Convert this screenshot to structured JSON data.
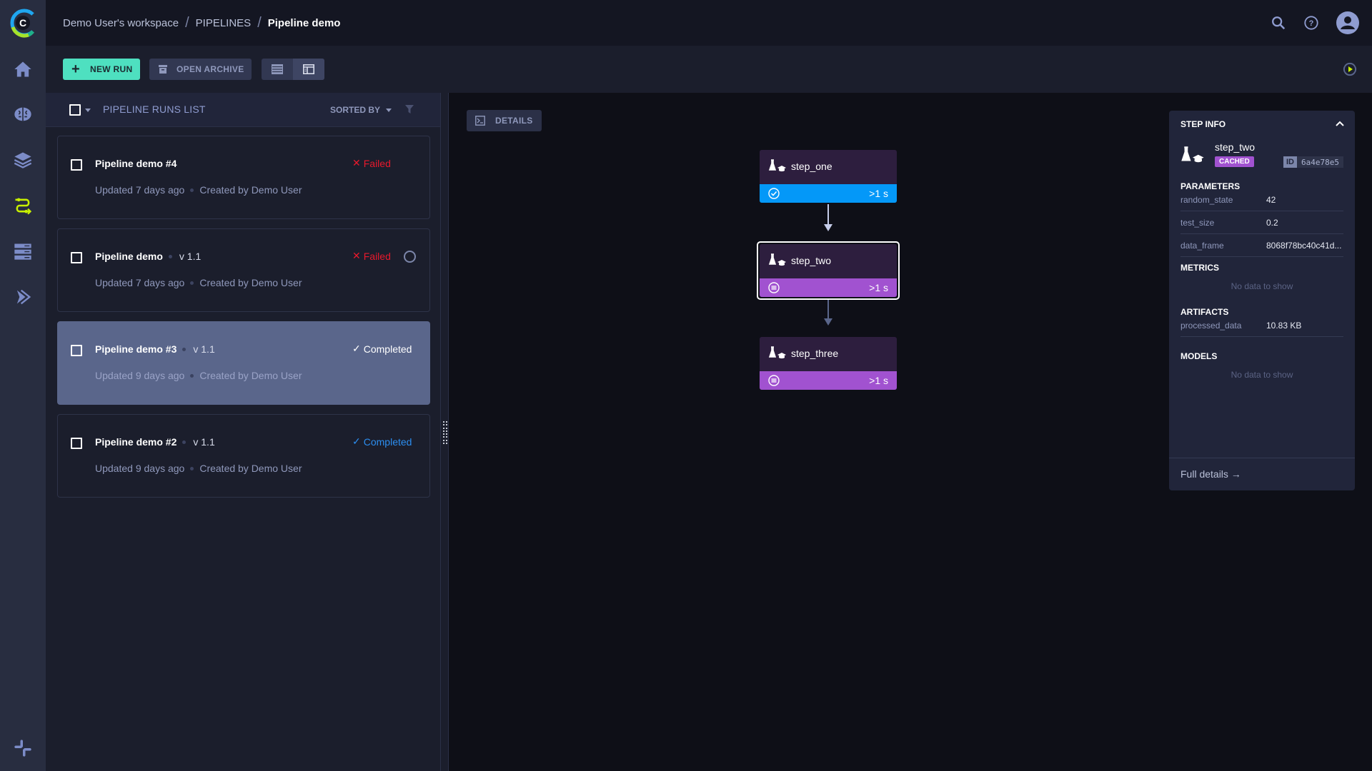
{
  "app": {
    "brand_colors": {
      "accent_green": "#4ee0c0",
      "active_nav": "#c8f000",
      "failed": "#e8192c",
      "completed_blue": "#2c8ef0",
      "step_blue": "#0498f8",
      "cached_purple": "#a152d0"
    }
  },
  "breadcrumb": {
    "workspace": "Demo User's workspace",
    "section": "PIPELINES",
    "current": "Pipeline demo",
    "separator": "/"
  },
  "sidebar": {
    "items": [
      {
        "name": "home",
        "icon": "home-icon"
      },
      {
        "name": "models",
        "icon": "brain-icon"
      },
      {
        "name": "datasets",
        "icon": "layers-icon"
      },
      {
        "name": "pipelines",
        "icon": "pipeline-icon",
        "active": true
      },
      {
        "name": "orchestration",
        "icon": "server-icon"
      },
      {
        "name": "deploy",
        "icon": "forward-icon"
      }
    ],
    "bottom": {
      "name": "slack",
      "icon": "slack-icon"
    }
  },
  "header_icons": {
    "search": "search-icon",
    "help": "help-icon",
    "profile": "user-avatar-icon"
  },
  "toolbar": {
    "new_run_label": "NEW RUN",
    "open_archive_label": "OPEN ARCHIVE",
    "views": [
      "table-view",
      "details-view"
    ],
    "active_view": "details-view"
  },
  "list": {
    "title": "PIPELINE RUNS LIST",
    "sort_label": "SORTED BY",
    "runs": [
      {
        "name": "Pipeline demo #4",
        "version": "",
        "status": "Failed",
        "updated": "Updated 7 days ago",
        "created_by": "Created by Demo User",
        "selected": false
      },
      {
        "name": "Pipeline demo",
        "version": "v 1.1",
        "status": "Failed",
        "updated": "Updated 7 days ago",
        "created_by": "Created by Demo User",
        "selected": false
      },
      {
        "name": "Pipeline demo #3",
        "version": "v 1.1",
        "status": "Completed",
        "updated": "Updated 9 days ago",
        "created_by": "Created by Demo User",
        "selected": true
      },
      {
        "name": "Pipeline demo #2",
        "version": "v 1.1",
        "status": "Completed",
        "updated": "Updated 9 days ago",
        "created_by": "Created by Demo User",
        "selected": false
      }
    ]
  },
  "canvas": {
    "details_label": "DETAILS",
    "steps": [
      {
        "name": "step_one",
        "duration": ">1 s",
        "state": "completed"
      },
      {
        "name": "step_two",
        "duration": ">1 s",
        "state": "cached",
        "selected": true
      },
      {
        "name": "step_three",
        "duration": ">1 s",
        "state": "cached"
      }
    ]
  },
  "step_info": {
    "title": "STEP INFO",
    "step_name": "step_two",
    "badge": "CACHED",
    "id_label": "ID",
    "id_value": "6a4e78e5",
    "parameters_title": "PARAMETERS",
    "parameters": [
      {
        "key": "random_state",
        "value": "42"
      },
      {
        "key": "test_size",
        "value": "0.2"
      },
      {
        "key": "data_frame",
        "value": "8068f78bc40c41d..."
      }
    ],
    "metrics_title": "METRICS",
    "metrics_empty": "No data to show",
    "artifacts_title": "ARTIFACTS",
    "artifacts": [
      {
        "key": "processed_data",
        "value": "10.83 KB"
      }
    ],
    "models_title": "MODELS",
    "models_empty": "No data to show",
    "full_details": "Full details →"
  }
}
